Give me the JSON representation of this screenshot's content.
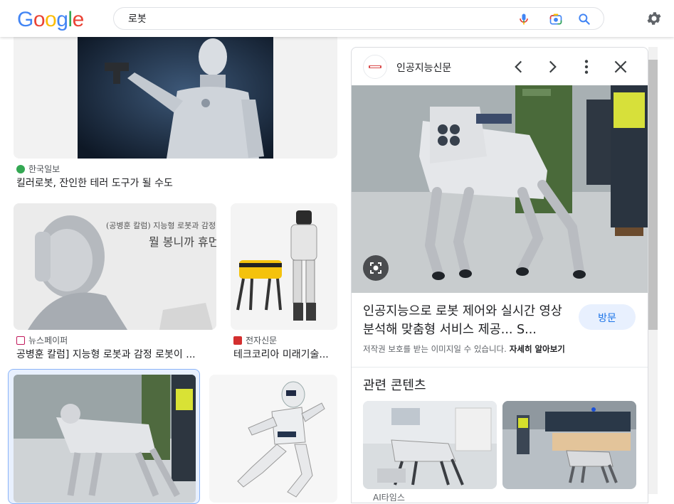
{
  "header": {
    "logo_letters": [
      {
        "ch": "G",
        "color": "#4285F4"
      },
      {
        "ch": "o",
        "color": "#EA4335"
      },
      {
        "ch": "o",
        "color": "#FBBC05"
      },
      {
        "ch": "g",
        "color": "#4285F4"
      },
      {
        "ch": "l",
        "color": "#34A853"
      },
      {
        "ch": "e",
        "color": "#EA4335"
      }
    ],
    "search_value": "로봇"
  },
  "results": [
    {
      "source": "한국일보",
      "caption": "킬러로봇, 잔인한 테러 도구가 될 수도",
      "fav_color": "#34A853"
    },
    {
      "source": "뉴스페이퍼",
      "caption": "공병훈 칼럼] 지능형 로봇과 감정 로봇이 ...",
      "fav_color": "#c2185b"
    },
    {
      "source": "전자신문",
      "caption": "테크코리아 미래기술...",
      "fav_color": "#d32f2f"
    }
  ],
  "panel": {
    "source_name": "인공지능신문",
    "title": "인공지능으로 로봇 제어와 실시간 영상 분석해 맞춤형 서비스 제공... S...",
    "visit_label": "방문",
    "copyright": "저작권 보호를 받는 이미지일 수 있습니다.",
    "learn_more": "자세히 알아보기",
    "related_heading": "관련 콘텐츠",
    "related_text": "AI타임스"
  },
  "colors": {
    "accent": "#1a73e8",
    "visit_bg": "#e8f0fe"
  }
}
